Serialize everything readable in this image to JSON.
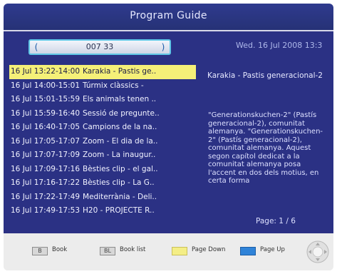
{
  "header": {
    "title": "Program Guide"
  },
  "channel": {
    "value": "007 33",
    "left_glyph": "(",
    "right_glyph": ")"
  },
  "datetime": "Wed.  16 Jul 2008 13:3",
  "epg": {
    "items": [
      {
        "time": "16 Jul 13:22-14:00",
        "title": "Karakia - Pastis ge..",
        "selected": true
      },
      {
        "time": "16 Jul 14:00-15:01",
        "title": "Túrmix clàssics -",
        "selected": false
      },
      {
        "time": "16 Jul 15:01-15:59",
        "title": "Els animals tenen ..",
        "selected": false
      },
      {
        "time": "16 Jul 15:59-16:40",
        "title": "Sessió de pregunte..",
        "selected": false
      },
      {
        "time": "16 Jul 16:40-17:05",
        "title": "Campions de la na..",
        "selected": false
      },
      {
        "time": "16 Jul 17:05-17:07",
        "title": "Zoom - El dia de la..",
        "selected": false
      },
      {
        "time": "16 Jul 17:07-17:09",
        "title": "Zoom - La inaugur..",
        "selected": false
      },
      {
        "time": "16 Jul 17:09-17:16",
        "title": "Bèsties clip - el gal..",
        "selected": false
      },
      {
        "time": "16 Jul 17:16-17:22",
        "title": "Bèsties clip - La G..",
        "selected": false
      },
      {
        "time": "16 Jul 17:22-17:49",
        "title": "Mediterrània - Deli..",
        "selected": false
      },
      {
        "time": "16 Jul 17:49-17:53",
        "title": "H20 - PROJECTE R..",
        "selected": false
      }
    ]
  },
  "detail": {
    "title": "Karakia - Pastis generacional-2",
    "description": "\"Generationskuchen-2\" (Pastís generacional-2), comunitat alemanya. \"Generationskuchen-2\" (Pastís generacional-2), comunitat alemanya. Aquest segon capítol dedicat a la comunitat alemanya posa l'accent en dos dels motius, en certa forma",
    "page": "Page: 1 / 6"
  },
  "footer": {
    "legend": [
      {
        "key_text": "B",
        "label": "Book",
        "color": "gray"
      },
      {
        "key_text": "BL",
        "label": "Book list",
        "color": "gray"
      },
      {
        "key_text": "",
        "label": "Page Down",
        "color": "yellow"
      },
      {
        "key_text": "",
        "label": "Page Up",
        "color": "blue"
      }
    ]
  },
  "colors": {
    "panel": "#2b3184",
    "header": "#2f3a8e",
    "selection": "#f5f078",
    "yellow_key": "#f4ee86",
    "blue_key": "#2f83d8"
  }
}
